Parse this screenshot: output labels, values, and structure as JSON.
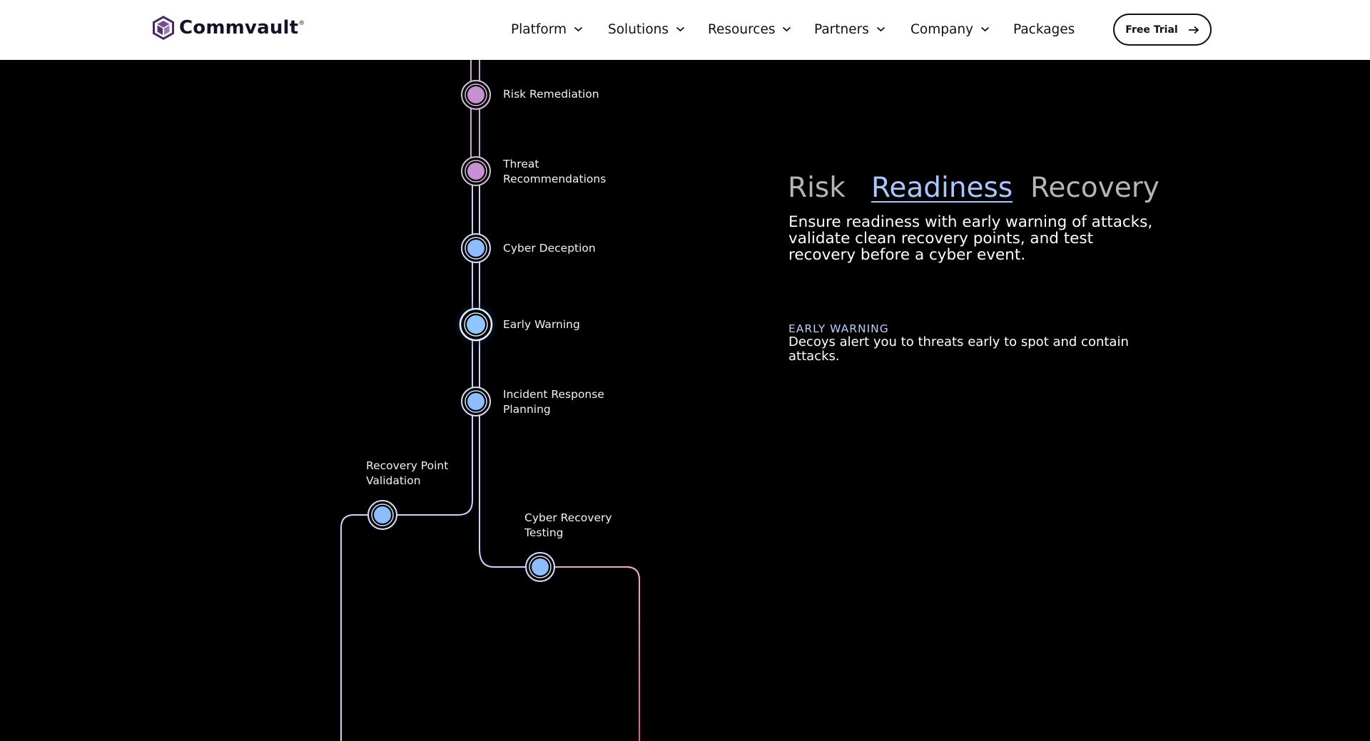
{
  "header": {
    "logo_text": "Commvault",
    "logo_mark": "®",
    "nav": [
      {
        "label": "Platform",
        "has_dropdown": true
      },
      {
        "label": "Solutions",
        "has_dropdown": true
      },
      {
        "label": "Resources",
        "has_dropdown": true
      },
      {
        "label": "Partners",
        "has_dropdown": true
      },
      {
        "label": "Company",
        "has_dropdown": true
      },
      {
        "label": "Packages",
        "has_dropdown": false
      }
    ],
    "cta_label": "Free Trial",
    "cta_icon": "arrow-right-icon"
  },
  "timeline": {
    "nodes": [
      {
        "label": "Risk Remediation",
        "color": "#c98fd4",
        "active": false
      },
      {
        "label": "Threat\nRecommendations",
        "color": "#c98fd4",
        "active": false
      },
      {
        "label": "Cyber Deception",
        "color": "#8ebdff",
        "active": false
      },
      {
        "label": "Early Warning",
        "color": "#8ebdff",
        "active": true
      },
      {
        "label": "Incident Response\nPlanning",
        "color": "#8ebdff",
        "active": false
      },
      {
        "label": "Recovery Point\nValidation",
        "color": "#8ebdff",
        "active": false
      },
      {
        "label": "Cyber Recovery\nTesting",
        "color": "#8ebdff",
        "active": false
      }
    ],
    "line_colors": {
      "purple": "#c9a6d8",
      "blue": "#c8d6ff",
      "pink": "#e77d92"
    }
  },
  "panel": {
    "tabs": [
      {
        "label": "Risk",
        "active": false
      },
      {
        "label": "Readiness",
        "active": true
      },
      {
        "label": "Recovery",
        "active": false
      }
    ],
    "description": "Ensure readiness with early warning of attacks, validate clean recovery points, and test recovery before a cyber event.",
    "detail_title": "EARLY WARNING",
    "detail_text": "Decoys alert you to threats early to spot and contain attacks."
  }
}
